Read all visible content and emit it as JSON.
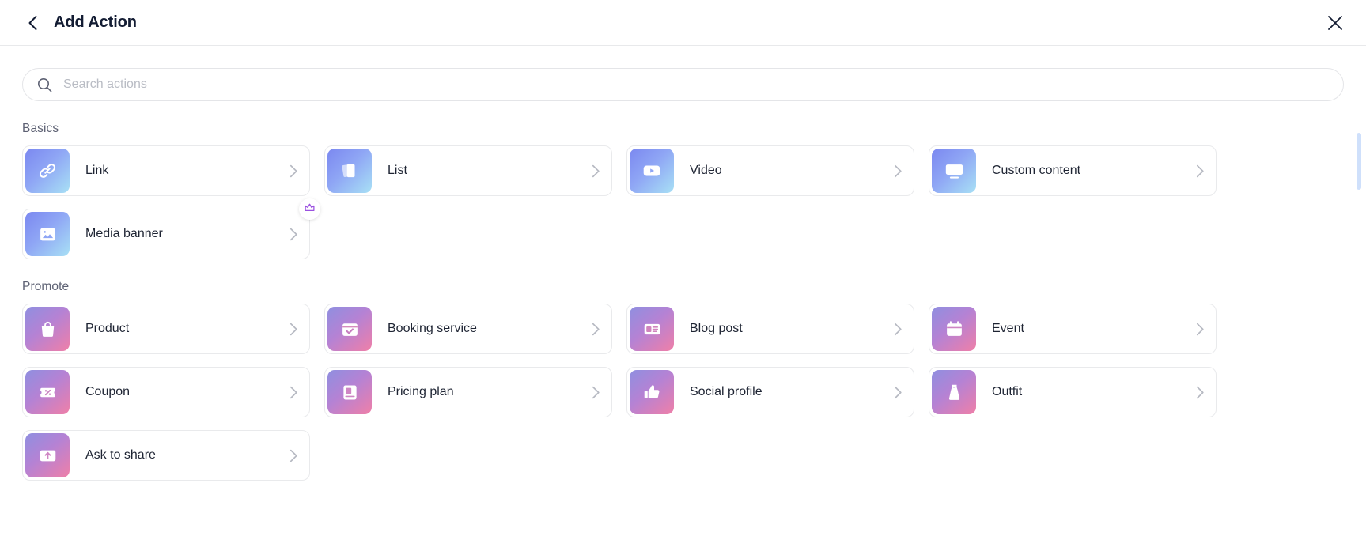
{
  "header": {
    "title": "Add Action",
    "back_icon": "chevron-left-icon",
    "close_icon": "close-icon"
  },
  "search": {
    "placeholder": "Search actions",
    "value": "",
    "icon": "search-icon"
  },
  "sections": [
    {
      "title": "Basics",
      "palette": "g-blue",
      "items": [
        {
          "label": "Link",
          "icon": "link-icon",
          "badge": null
        },
        {
          "label": "List",
          "icon": "cards-stack-icon",
          "badge": null
        },
        {
          "label": "Video",
          "icon": "video-play-icon",
          "badge": null
        },
        {
          "label": "Custom content",
          "icon": "monitor-icon",
          "badge": null
        },
        {
          "label": "Media banner",
          "icon": "image-icon",
          "badge": "crown-icon"
        }
      ]
    },
    {
      "title": "Promote",
      "palette": "g-pink",
      "items": [
        {
          "label": "Product",
          "icon": "shopping-bag-icon",
          "badge": null
        },
        {
          "label": "Booking service",
          "icon": "calendar-check-icon",
          "badge": null
        },
        {
          "label": "Blog post",
          "icon": "article-icon",
          "badge": null
        },
        {
          "label": "Event",
          "icon": "calendar-icon",
          "badge": null
        },
        {
          "label": "Coupon",
          "icon": "ticket-percent-icon",
          "badge": null
        },
        {
          "label": "Pricing plan",
          "icon": "pricing-card-icon",
          "badge": null
        },
        {
          "label": "Social profile",
          "icon": "thumbs-up-icon",
          "badge": null
        },
        {
          "label": "Outfit",
          "icon": "dress-icon",
          "badge": null
        },
        {
          "label": "Ask to share",
          "icon": "share-image-icon",
          "badge": null
        }
      ]
    }
  ],
  "chevron_icon": "chevron-right-icon",
  "scrollbar": {
    "name": "vertical-scrollbar"
  },
  "colors": {
    "basics_gradient_from": "#7b88f0",
    "basics_gradient_to": "#a8e0f5",
    "promote_gradient_from": "#8f8fe0",
    "promote_gradient_to": "#ef7fa8",
    "crown": "#9b51e0",
    "title": "#131c33",
    "scrollbar_thumb": "#cfe0fb"
  }
}
